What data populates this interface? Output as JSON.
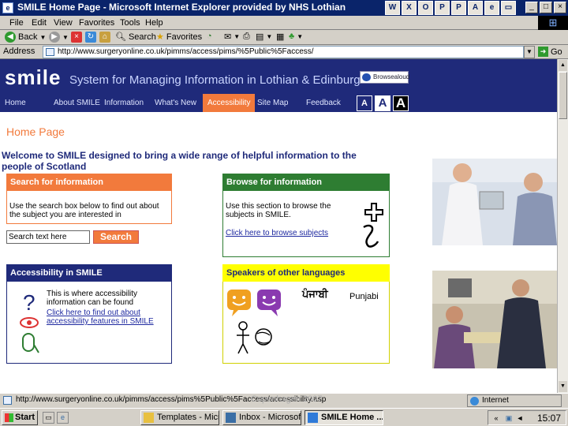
{
  "window": {
    "title": "SMILE Home Page - Microsoft Internet Explorer provided by NHS Lothian",
    "controls": [
      "_",
      "□",
      "×"
    ]
  },
  "menu": [
    "File",
    "Edit",
    "View",
    "Favorites",
    "Tools",
    "Help"
  ],
  "toolbar": {
    "back": "Back",
    "search": "Search",
    "favorites": "Favorites"
  },
  "address": {
    "label": "Address",
    "url": "http://www.surgeryonline.co.uk/pimms/access/pims/%5Public%5Faccess/",
    "go": "Go"
  },
  "site": {
    "logo": "smile",
    "tagline": "System for Managing Information in Lothian & Edinburgh",
    "browsealoud": "Browsealoud",
    "nav": [
      "Home",
      "About SMILE",
      "Information",
      "What's New",
      "Accessibility",
      "Site Map",
      "Feedback"
    ],
    "text_sizes": [
      "A",
      "A",
      "A"
    ],
    "page_title": "Home Page",
    "welcome": "Welcome to SMILE designed to bring a wide range of helpful information to the people of Scotland",
    "search_panel": {
      "heading": "Search for information",
      "text": "Use the search box below to find out about the subject you are interested in",
      "input_value": "Search text here",
      "button": "Search"
    },
    "browse_panel": {
      "heading": "Browse for information",
      "text": "Use this section to browse the subjects in SMILE.",
      "link": "Click here to browse subjects"
    },
    "access_panel": {
      "heading": "Accessibility in SMILE",
      "text": "This is where accessibility information can be found",
      "link": "Click here to find out about accessibility features in SMILE"
    },
    "languages_panel": {
      "heading": "Speakers of other languages",
      "script_word": "ਪੰਜਾਬੀ",
      "language": "Punjabi"
    },
    "colors": {
      "navy": "#1f2a7a",
      "orange": "#f27a3c",
      "green": "#2e7d32",
      "yellow": "#ffff00"
    }
  },
  "status": {
    "text": "http://www.surgeryonline.co.uk/pimms/access/pims%5Public%5Faccess/accessibility.asp",
    "zone": "Internet",
    "watermark": "Copenhagen 2007"
  },
  "taskbar": {
    "start": "Start",
    "tasks": [
      "Templates - Micr...",
      "Inbox - Microsof...",
      "SMILE Home ..."
    ],
    "clock": "15:07"
  }
}
